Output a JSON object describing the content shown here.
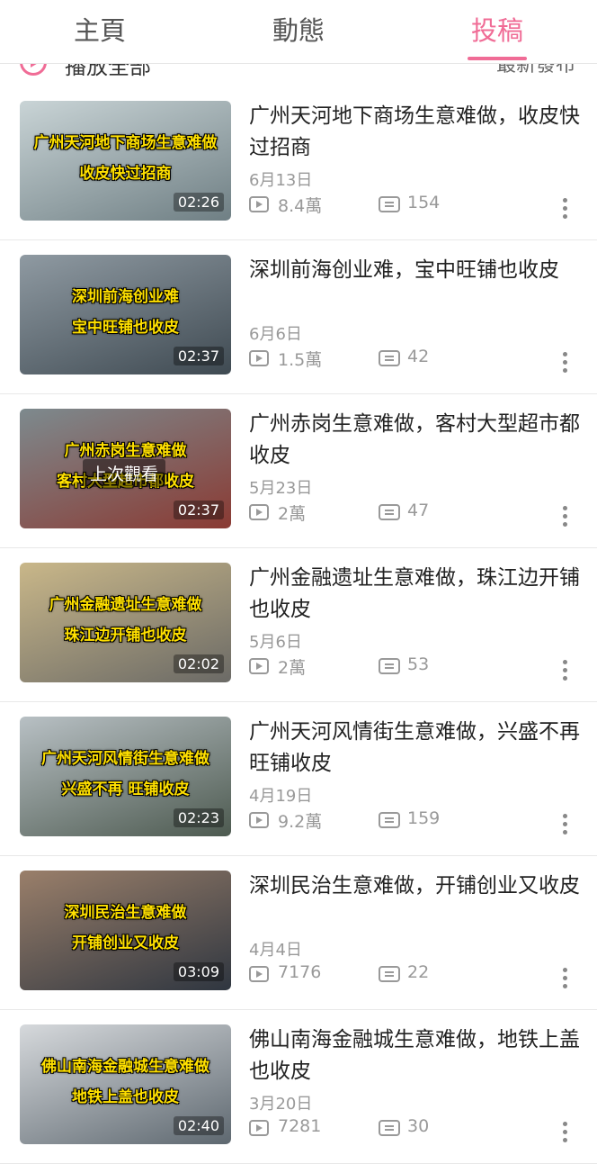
{
  "tabs": [
    "主頁",
    "動態",
    "投稿"
  ],
  "active_tab": 2,
  "accent_color": "#f06c96",
  "subheader": {
    "play_all": "播放全部",
    "sort": "最新發布"
  },
  "last_watched_label": "上次觀看",
  "videos": [
    {
      "title": "广州天河地下商场生意难做，收皮快过招商",
      "caption_lines": [
        "广州天河地下商场生意难做",
        "收皮快过招商"
      ],
      "duration": "02:26",
      "date": "6月13日",
      "views": "8.4萬",
      "comments": "154",
      "thumb_colors": [
        "#c9d4d6",
        "#6f7f84"
      ]
    },
    {
      "title": "深圳前海创业难，宝中旺铺也收皮",
      "caption_lines": [
        "深圳前海创业难",
        "宝中旺铺也收皮"
      ],
      "duration": "02:37",
      "date": "6月6日",
      "views": "1.5萬",
      "comments": "42",
      "thumb_colors": [
        "#8f9aa2",
        "#3f4a52"
      ]
    },
    {
      "title": "广州赤岗生意难做，客村大型超市都收皮",
      "caption_lines": [
        "广州赤岗生意难做",
        "客村大型超市都收皮"
      ],
      "duration": "02:37",
      "date": "5月23日",
      "views": "2萬",
      "comments": "47",
      "thumb_colors": [
        "#7d8a8e",
        "#8a3a33"
      ]
    },
    {
      "title": "广州金融遗址生意难做，珠江边开铺也收皮",
      "caption_lines": [
        "广州金融遗址生意难做",
        "珠江边开铺也收皮"
      ],
      "duration": "02:02",
      "date": "5月6日",
      "views": "2萬",
      "comments": "53",
      "thumb_colors": [
        "#c9b789",
        "#6b6a66"
      ]
    },
    {
      "title": "广州天河风情街生意难做，兴盛不再旺铺收皮",
      "caption_lines": [
        "广州天河风情街生意难做",
        "兴盛不再 旺铺收皮"
      ],
      "duration": "02:23",
      "date": "4月19日",
      "views": "9.2萬",
      "comments": "159",
      "thumb_colors": [
        "#b8c0c4",
        "#4d5a50"
      ]
    },
    {
      "title": "深圳民治生意难做，开铺创业又收皮",
      "caption_lines": [
        "深圳民治生意难做",
        "开铺创业又收皮"
      ],
      "duration": "03:09",
      "date": "4月4日",
      "views": "7176",
      "comments": "22",
      "thumb_colors": [
        "#9a7f6a",
        "#2f3640"
      ]
    },
    {
      "title": "佛山南海金融城生意难做，地铁上盖也收皮",
      "caption_lines": [
        "佛山南海金融城生意难做",
        "地铁上盖也收皮"
      ],
      "duration": "02:40",
      "date": "3月20日",
      "views": "7281",
      "comments": "30",
      "thumb_colors": [
        "#d6d9dc",
        "#5e6870"
      ]
    }
  ]
}
